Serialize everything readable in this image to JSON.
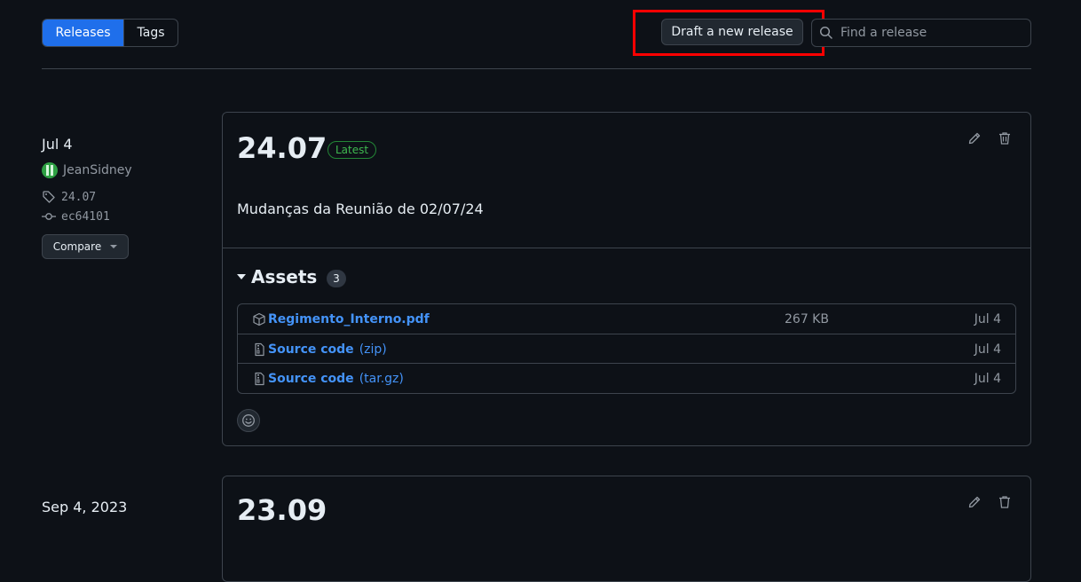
{
  "toolbar": {
    "releases_tab": "Releases",
    "tags_tab": "Tags",
    "draft_button": "Draft a new release",
    "search_placeholder": "Find a release"
  },
  "releases": [
    {
      "date": "Jul 4",
      "author": "JeanSidney",
      "tag": "24.07",
      "commit": "ec64101",
      "compare_label": "Compare",
      "title": "24.07",
      "badge": "Latest",
      "body": "Mudanças da Reunião de 02/07/24",
      "assets_label": "Assets",
      "assets_count": "3",
      "assets": [
        {
          "name": "Regimento_Interno.pdf",
          "ext": "",
          "size": "267 KB",
          "date": "Jul 4",
          "icon": "package-icon"
        },
        {
          "name": "Source code",
          "ext": "(zip)",
          "size": "",
          "date": "Jul 4",
          "icon": "file-zip-icon"
        },
        {
          "name": "Source code",
          "ext": "(tar.gz)",
          "size": "",
          "date": "Jul 4",
          "icon": "file-zip-icon"
        }
      ]
    },
    {
      "date": "Sep 4, 2023",
      "title": "23.09"
    }
  ],
  "colors": {
    "background": "#0d1117",
    "accent": "#1f6feb",
    "link": "#4493f8",
    "latest_badge": "#3fb950",
    "highlight": "#ff0000"
  }
}
